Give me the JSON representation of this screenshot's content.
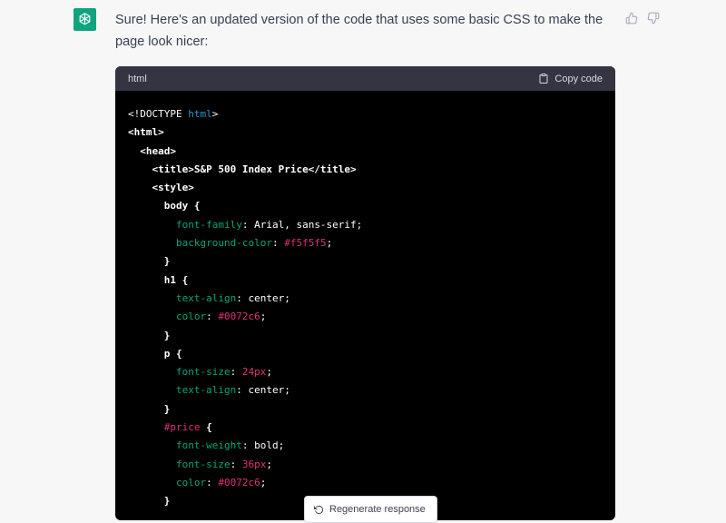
{
  "message": {
    "text": "Sure! Here's an updated version of the code that uses some basic CSS to make the page look nicer:",
    "avatar_icon": "openai-logo-icon",
    "avatar_color": "#10a37f"
  },
  "feedback": {
    "like_icon": "thumbs-up-icon",
    "dislike_icon": "thumbs-down-icon"
  },
  "code_block": {
    "language": "html",
    "copy_label": "Copy code",
    "copy_icon": "clipboard-icon",
    "lines": [
      [
        [
          "meta",
          "<!DOCTYPE "
        ],
        [
          "kw",
          "html"
        ],
        [
          "meta",
          ">"
        ]
      ],
      [
        [
          "tag",
          "<html>"
        ]
      ],
      [
        [
          "plain",
          "  "
        ],
        [
          "tag",
          "<head>"
        ]
      ],
      [
        [
          "plain",
          "    "
        ],
        [
          "tag",
          "<title>S&P 500 Index Price</title>"
        ]
      ],
      [
        [
          "plain",
          "    "
        ],
        [
          "tag",
          "<style>"
        ]
      ],
      [
        [
          "plain",
          "      "
        ],
        [
          "tag",
          "body {"
        ]
      ],
      [
        [
          "plain",
          "        "
        ],
        [
          "prop",
          "font-family"
        ],
        [
          "val",
          ": Arial, sans-serif;"
        ]
      ],
      [
        [
          "plain",
          "        "
        ],
        [
          "prop",
          "background-color"
        ],
        [
          "val",
          ": "
        ],
        [
          "hash",
          "#f5f5f5"
        ],
        [
          "val",
          ";"
        ]
      ],
      [
        [
          "plain",
          "      "
        ],
        [
          "tag",
          "}"
        ]
      ],
      [
        [
          "plain",
          "      "
        ],
        [
          "tag",
          "h1 {"
        ]
      ],
      [
        [
          "plain",
          "        "
        ],
        [
          "prop",
          "text-align"
        ],
        [
          "val",
          ": center;"
        ]
      ],
      [
        [
          "plain",
          "        "
        ],
        [
          "prop",
          "color"
        ],
        [
          "val",
          ": "
        ],
        [
          "hash",
          "#0072c6"
        ],
        [
          "val",
          ";"
        ]
      ],
      [
        [
          "plain",
          "      "
        ],
        [
          "tag",
          "}"
        ]
      ],
      [
        [
          "plain",
          "      "
        ],
        [
          "tag",
          "p {"
        ]
      ],
      [
        [
          "plain",
          "        "
        ],
        [
          "prop",
          "font-size"
        ],
        [
          "val",
          ": "
        ],
        [
          "num",
          "24px"
        ],
        [
          "val",
          ";"
        ]
      ],
      [
        [
          "plain",
          "        "
        ],
        [
          "prop",
          "text-align"
        ],
        [
          "val",
          ": center;"
        ]
      ],
      [
        [
          "plain",
          "      "
        ],
        [
          "tag",
          "}"
        ]
      ],
      [
        [
          "plain",
          "      "
        ],
        [
          "sel",
          "#price"
        ],
        [
          "tag",
          " {"
        ]
      ],
      [
        [
          "plain",
          "        "
        ],
        [
          "prop",
          "font-weight"
        ],
        [
          "val",
          ": bold;"
        ]
      ],
      [
        [
          "plain",
          "        "
        ],
        [
          "prop",
          "font-size"
        ],
        [
          "val",
          ": "
        ],
        [
          "num",
          "36px"
        ],
        [
          "val",
          ";"
        ]
      ],
      [
        [
          "plain",
          "        "
        ],
        [
          "prop",
          "color"
        ],
        [
          "val",
          ": "
        ],
        [
          "hash",
          "#0072c6"
        ],
        [
          "val",
          ";"
        ]
      ],
      [
        [
          "plain",
          "      "
        ],
        [
          "tag",
          "}"
        ]
      ]
    ]
  },
  "regenerate": {
    "label": "Regenerate response",
    "icon": "refresh-icon"
  },
  "colors": {
    "accent": "#10a37f",
    "code_bg": "#000000",
    "code_header_bg": "#343541"
  }
}
